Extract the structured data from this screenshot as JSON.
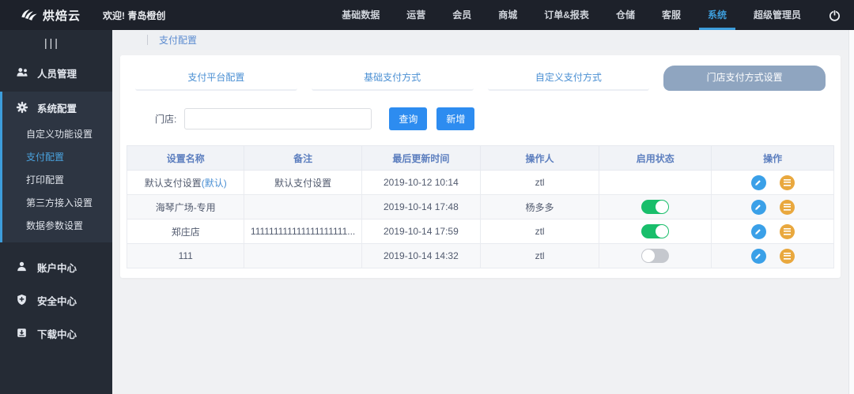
{
  "topbar": {
    "logo_text": "烘焙云",
    "welcome": "欢迎! 青岛橙创",
    "nav": [
      {
        "label": "基础数据",
        "active": false
      },
      {
        "label": "运营",
        "active": false
      },
      {
        "label": "会员",
        "active": false
      },
      {
        "label": "商城",
        "active": false
      },
      {
        "label": "订单&报表",
        "active": false
      },
      {
        "label": "仓储",
        "active": false
      },
      {
        "label": "客服",
        "active": false
      },
      {
        "label": "系统",
        "active": true
      },
      {
        "label": "超级管理员",
        "active": false
      }
    ]
  },
  "sidebar": {
    "collapse_glyph": "|||",
    "items": [
      {
        "label": "人员管理"
      },
      {
        "label": "系统配置",
        "expanded": true
      },
      {
        "label": "账户中心"
      },
      {
        "label": "安全中心"
      },
      {
        "label": "下载中心"
      }
    ],
    "system_config_children": [
      {
        "label": "自定义功能设置",
        "active": false
      },
      {
        "label": "支付配置",
        "active": true
      },
      {
        "label": "打印配置",
        "active": false
      },
      {
        "label": "第三方接入设置",
        "active": false
      },
      {
        "label": "数据参数设置",
        "active": false
      }
    ]
  },
  "breadcrumb": "支付配置",
  "tabs": [
    {
      "label": "支付平台配置",
      "active": false
    },
    {
      "label": "基础支付方式",
      "active": false
    },
    {
      "label": "自定义支付方式",
      "active": false
    },
    {
      "label": "门店支付方式设置",
      "active": true
    }
  ],
  "form": {
    "store_label": "门店:",
    "store_value": "",
    "search_button": "查询",
    "add_button": "新增"
  },
  "table": {
    "headers": [
      "设置名称",
      "备注",
      "最后更新时间",
      "操作人",
      "启用状态",
      "操作"
    ],
    "rows": [
      {
        "name": "默认支付设置",
        "name_suffix": "(默认)",
        "remark": "默认支付设置",
        "updated": "2019-10-12 10:14",
        "operator": "ztl",
        "toggle_state": "none"
      },
      {
        "name": "海琴广场-专用",
        "name_suffix": "",
        "remark": "",
        "updated": "2019-10-14 17:48",
        "operator": "杨多多",
        "toggle_state": "on"
      },
      {
        "name": "郑庄店",
        "name_suffix": "",
        "remark": "111111111111111111111...",
        "updated": "2019-10-14 17:59",
        "operator": "ztl",
        "toggle_state": "on"
      },
      {
        "name": "111",
        "name_suffix": "",
        "remark": "",
        "updated": "2019-10-14 14:32",
        "operator": "ztl",
        "toggle_state": "off"
      }
    ]
  },
  "icons": {
    "logo-icon": "three-wings",
    "collapse-icon": "triple-bar",
    "power-icon": "power-symbol",
    "users-icon": "two-people",
    "gear-icon": "gear",
    "account-icon": "person",
    "shield-icon": "shield-plus",
    "download-icon": "box-arrow-down",
    "edit-icon": "pencil-in-blue-circle",
    "detail-icon": "lines-in-orange-circle"
  },
  "colors": {
    "topbar_bg": "#1d212a",
    "sidebar_bg": "#252b35",
    "accent_blue": "#3d9ddb",
    "button_blue": "#2d8cf0",
    "active_tab_bg": "#8fa5c0",
    "header_text_blue": "#5d7fbf",
    "toggle_on": "#19be6b",
    "toggle_off": "#c5c8ce",
    "edit_icon_bg": "#3aa0e8",
    "detail_icon_bg": "#e9a83e"
  }
}
